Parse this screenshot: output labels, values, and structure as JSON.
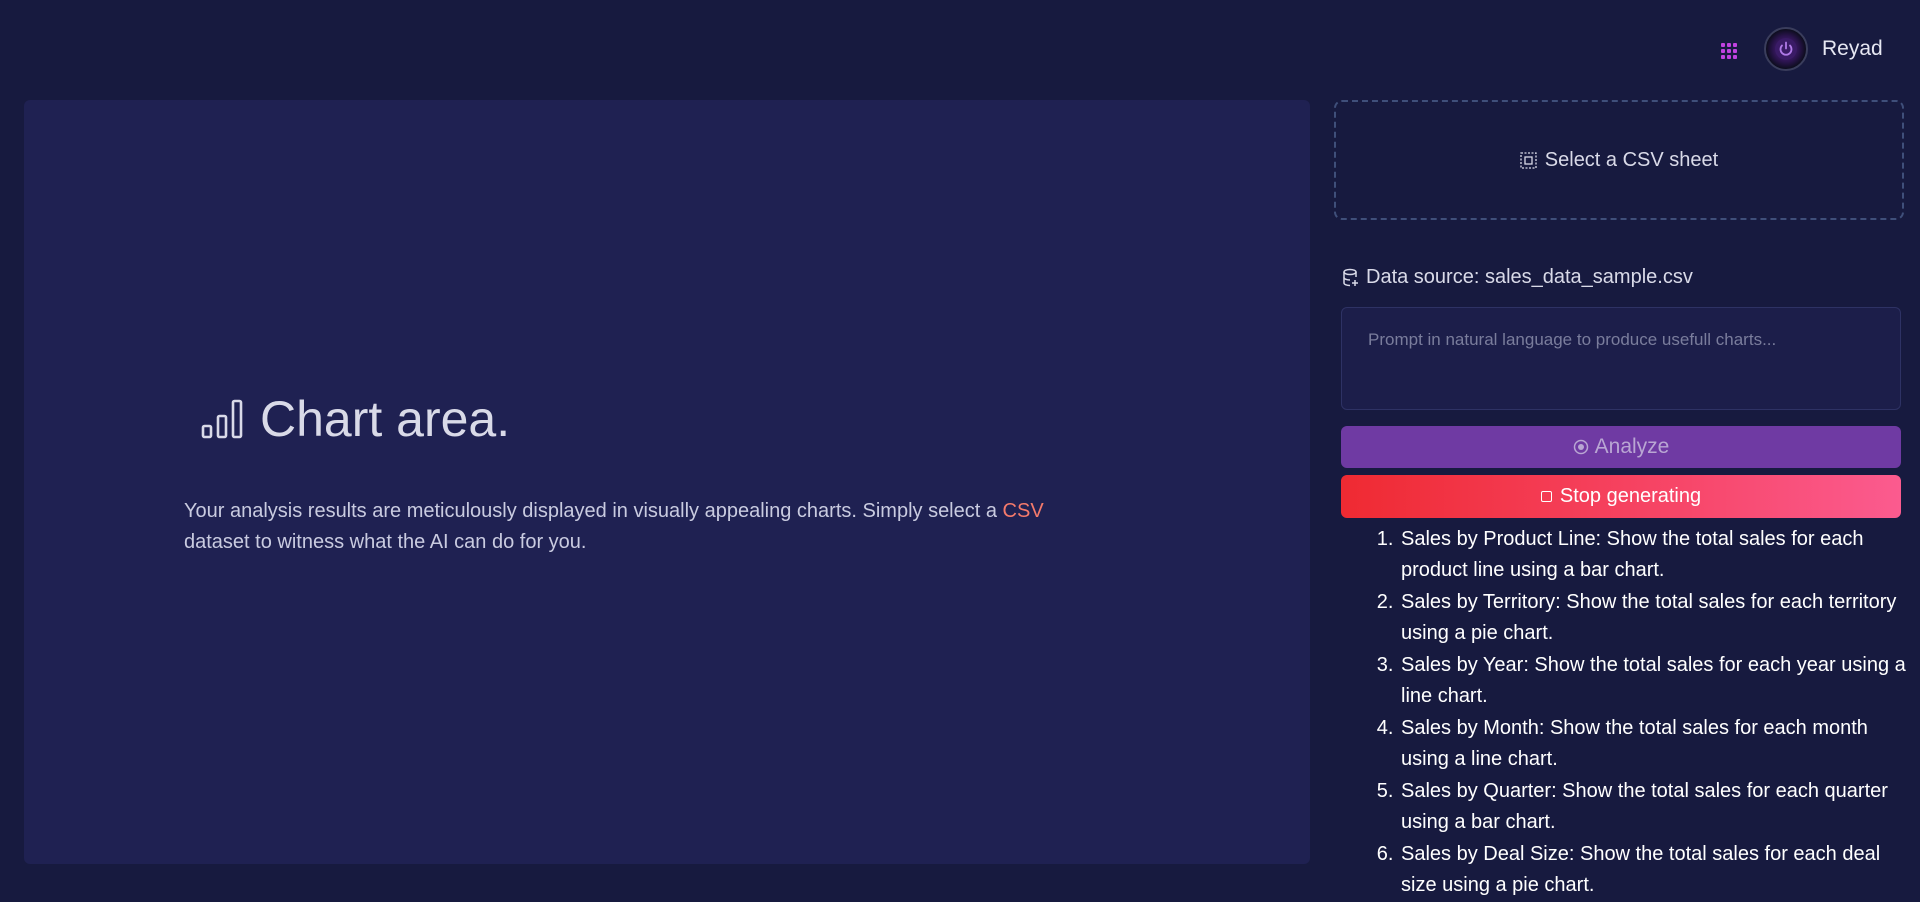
{
  "header": {
    "username": "Reyad",
    "apps_icon": "grid-apps-icon",
    "avatar_icon": "power-avatar"
  },
  "chart_area": {
    "title": "Chart area.",
    "description_before": "Your analysis results are meticulously displayed in visually appealing charts. Simply select a ",
    "csv_link": "CSV",
    "description_after": " dataset to witness what the AI can do for you."
  },
  "sidebar": {
    "upload_label": "Select a CSV sheet",
    "datasource_label": "Data source: sales_data_sample.csv",
    "prompt_placeholder": "Prompt in natural language to produce usefull charts...",
    "prompt_value": "",
    "analyze_label": "Analyze",
    "stop_label": "Stop generating",
    "suggestions": [
      "Sales by Product Line: Show the total sales for each product line using a bar chart.",
      "Sales by Territory: Show the total sales for each territory using a pie chart.",
      "Sales by Year: Show the total sales for each year using a line chart.",
      "Sales by Month: Show the total sales for each month using a line chart.",
      "Sales by Quarter: Show the total sales for each quarter using a bar chart.",
      "Sales by Deal Size: Show the total sales for each deal size using a pie chart."
    ]
  },
  "colors": {
    "background": "#171a3f",
    "panel": "#1f2152",
    "accent_link": "#f47a6b",
    "analyze_button": "#6f3aa3",
    "stop_button_start": "#ef2a32",
    "stop_button_end": "#fb5b8f",
    "apps_icon": "#c042e0"
  }
}
